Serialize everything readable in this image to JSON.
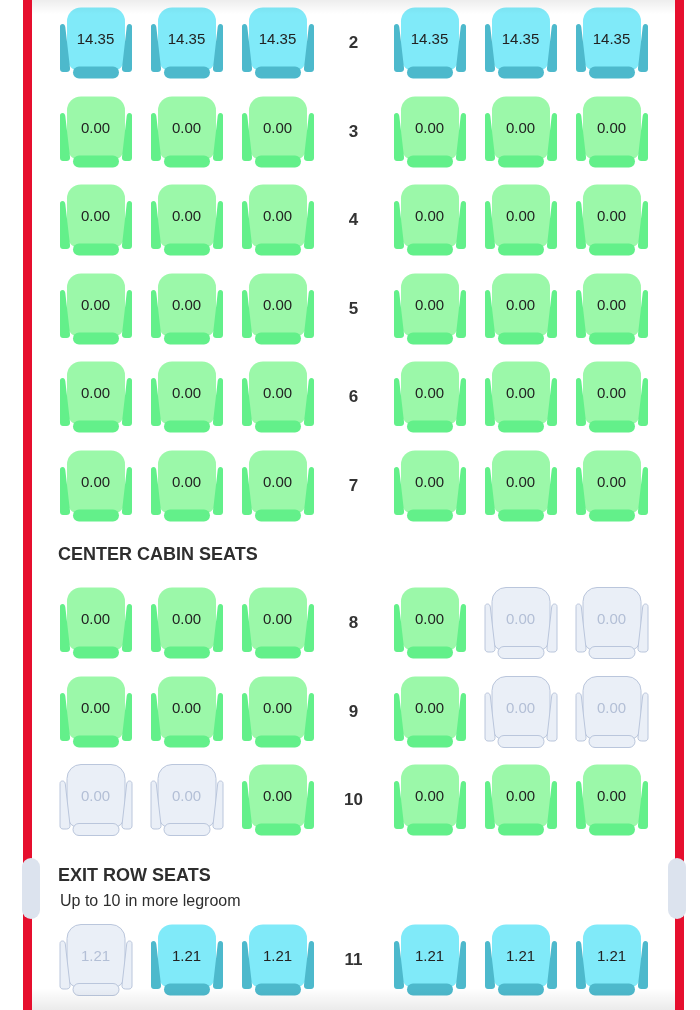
{
  "cabin": {
    "sections": [
      {
        "kind": "cabin",
        "rows": [
          {
            "number": "2",
            "seats": [
              {
                "price": "14.35",
                "kind": "premium",
                "available": true
              },
              {
                "price": "14.35",
                "kind": "premium",
                "available": true
              },
              {
                "price": "14.35",
                "kind": "premium",
                "available": true
              },
              {
                "price": "14.35",
                "kind": "premium",
                "available": true
              },
              {
                "price": "14.35",
                "kind": "premium",
                "available": true
              },
              {
                "price": "14.35",
                "kind": "premium",
                "available": true
              }
            ]
          },
          {
            "number": "3",
            "seats": [
              {
                "price": "0.00",
                "kind": "standard",
                "available": true
              },
              {
                "price": "0.00",
                "kind": "standard",
                "available": true
              },
              {
                "price": "0.00",
                "kind": "standard",
                "available": true
              },
              {
                "price": "0.00",
                "kind": "standard",
                "available": true
              },
              {
                "price": "0.00",
                "kind": "standard",
                "available": true
              },
              {
                "price": "0.00",
                "kind": "standard",
                "available": true
              }
            ]
          },
          {
            "number": "4",
            "seats": [
              {
                "price": "0.00",
                "kind": "standard",
                "available": true
              },
              {
                "price": "0.00",
                "kind": "standard",
                "available": true
              },
              {
                "price": "0.00",
                "kind": "standard",
                "available": true
              },
              {
                "price": "0.00",
                "kind": "standard",
                "available": true
              },
              {
                "price": "0.00",
                "kind": "standard",
                "available": true
              },
              {
                "price": "0.00",
                "kind": "standard",
                "available": true
              }
            ]
          },
          {
            "number": "5",
            "seats": [
              {
                "price": "0.00",
                "kind": "standard",
                "available": true
              },
              {
                "price": "0.00",
                "kind": "standard",
                "available": true
              },
              {
                "price": "0.00",
                "kind": "standard",
                "available": true
              },
              {
                "price": "0.00",
                "kind": "standard",
                "available": true
              },
              {
                "price": "0.00",
                "kind": "standard",
                "available": true
              },
              {
                "price": "0.00",
                "kind": "standard",
                "available": true
              }
            ]
          },
          {
            "number": "6",
            "seats": [
              {
                "price": "0.00",
                "kind": "standard",
                "available": true
              },
              {
                "price": "0.00",
                "kind": "standard",
                "available": true
              },
              {
                "price": "0.00",
                "kind": "standard",
                "available": true
              },
              {
                "price": "0.00",
                "kind": "standard",
                "available": true
              },
              {
                "price": "0.00",
                "kind": "standard",
                "available": true
              },
              {
                "price": "0.00",
                "kind": "standard",
                "available": true
              }
            ]
          },
          {
            "number": "7",
            "seats": [
              {
                "price": "0.00",
                "kind": "standard",
                "available": true
              },
              {
                "price": "0.00",
                "kind": "standard",
                "available": true
              },
              {
                "price": "0.00",
                "kind": "standard",
                "available": true
              },
              {
                "price": "0.00",
                "kind": "standard",
                "available": true
              },
              {
                "price": "0.00",
                "kind": "standard",
                "available": true
              },
              {
                "price": "0.00",
                "kind": "standard",
                "available": true
              }
            ]
          }
        ]
      },
      {
        "title": "CENTER CABIN SEATS",
        "kind": "cabin",
        "rows": [
          {
            "number": "8",
            "seats": [
              {
                "price": "0.00",
                "kind": "standard",
                "available": true
              },
              {
                "price": "0.00",
                "kind": "standard",
                "available": true
              },
              {
                "price": "0.00",
                "kind": "standard",
                "available": true
              },
              {
                "price": "0.00",
                "kind": "standard",
                "available": true
              },
              {
                "price": "0.00",
                "kind": "standard",
                "available": false
              },
              {
                "price": "0.00",
                "kind": "standard",
                "available": false
              }
            ]
          },
          {
            "number": "9",
            "seats": [
              {
                "price": "0.00",
                "kind": "standard",
                "available": true
              },
              {
                "price": "0.00",
                "kind": "standard",
                "available": true
              },
              {
                "price": "0.00",
                "kind": "standard",
                "available": true
              },
              {
                "price": "0.00",
                "kind": "standard",
                "available": true
              },
              {
                "price": "0.00",
                "kind": "standard",
                "available": false
              },
              {
                "price": "0.00",
                "kind": "standard",
                "available": false
              }
            ]
          },
          {
            "number": "10",
            "seats": [
              {
                "price": "0.00",
                "kind": "standard",
                "available": false
              },
              {
                "price": "0.00",
                "kind": "standard",
                "available": false
              },
              {
                "price": "0.00",
                "kind": "standard",
                "available": true
              },
              {
                "price": "0.00",
                "kind": "standard",
                "available": true
              },
              {
                "price": "0.00",
                "kind": "standard",
                "available": true
              },
              {
                "price": "0.00",
                "kind": "standard",
                "available": true
              }
            ]
          }
        ]
      },
      {
        "title": "EXIT ROW SEATS",
        "subtitle": "Up to 10 in more legroom",
        "kind": "exit",
        "rows": [
          {
            "number": "11",
            "seats": [
              {
                "price": "1.21",
                "kind": "premium",
                "available": false
              },
              {
                "price": "1.21",
                "kind": "premium",
                "available": true
              },
              {
                "price": "1.21",
                "kind": "premium",
                "available": true
              },
              {
                "price": "1.21",
                "kind": "premium",
                "available": true
              },
              {
                "price": "1.21",
                "kind": "premium",
                "available": true
              },
              {
                "price": "1.21",
                "kind": "premium",
                "available": true
              }
            ]
          }
        ]
      }
    ]
  }
}
